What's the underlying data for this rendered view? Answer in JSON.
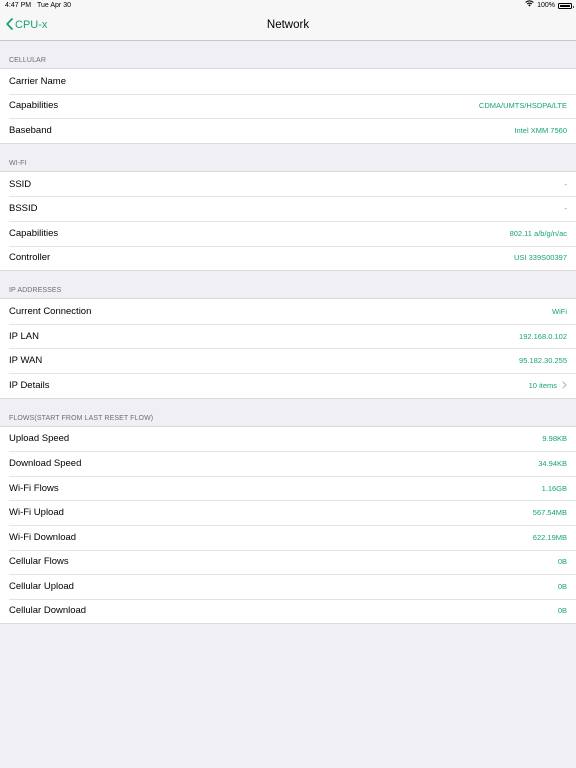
{
  "status_bar": {
    "time": "4:47 PM",
    "date": "Tue Apr 30",
    "battery_text": "100%"
  },
  "nav": {
    "back_label": "CPU-x",
    "title": "Network"
  },
  "colors": {
    "accent": "#16a37a",
    "background": "#efeff4"
  },
  "sections": [
    {
      "header": "CELLULAR",
      "rows": [
        {
          "label": "Carrier Name",
          "value": ""
        },
        {
          "label": "Capabilities",
          "value": "CDMA/UMTS/HSDPA/LTE"
        },
        {
          "label": "Baseband",
          "value": "Intel XMM 7560"
        }
      ]
    },
    {
      "header": "WI-FI",
      "rows": [
        {
          "label": "SSID",
          "value": "-"
        },
        {
          "label": "BSSID",
          "value": "-"
        },
        {
          "label": "Capabilities",
          "value": "802.11 a/b/g/n/ac"
        },
        {
          "label": "Controller",
          "value": "USI 339S00397"
        }
      ]
    },
    {
      "header": "IP ADDRESSES",
      "rows": [
        {
          "label": "Current Connection",
          "value": "WiFi"
        },
        {
          "label": "IP LAN",
          "value": "192.168.0.102"
        },
        {
          "label": "IP WAN",
          "value": "95.182.30.255"
        },
        {
          "label": "IP Details",
          "value": "10 items"
        }
      ]
    },
    {
      "header": "FLOWS(START FROM LAST RESET FLOW)",
      "rows": [
        {
          "label": "Upload Speed",
          "value": "9.98KB"
        },
        {
          "label": "Download Speed",
          "value": "34.94KB"
        },
        {
          "label": "Wi-Fi Flows",
          "value": "1.16GB"
        },
        {
          "label": "Wi-Fi Upload",
          "value": "567.54MB"
        },
        {
          "label": "Wi-Fi Download",
          "value": "622.19MB"
        },
        {
          "label": "Cellular Flows",
          "value": "0B"
        },
        {
          "label": "Cellular Upload",
          "value": "0B"
        },
        {
          "label": "Cellular Download",
          "value": "0B"
        }
      ]
    }
  ]
}
